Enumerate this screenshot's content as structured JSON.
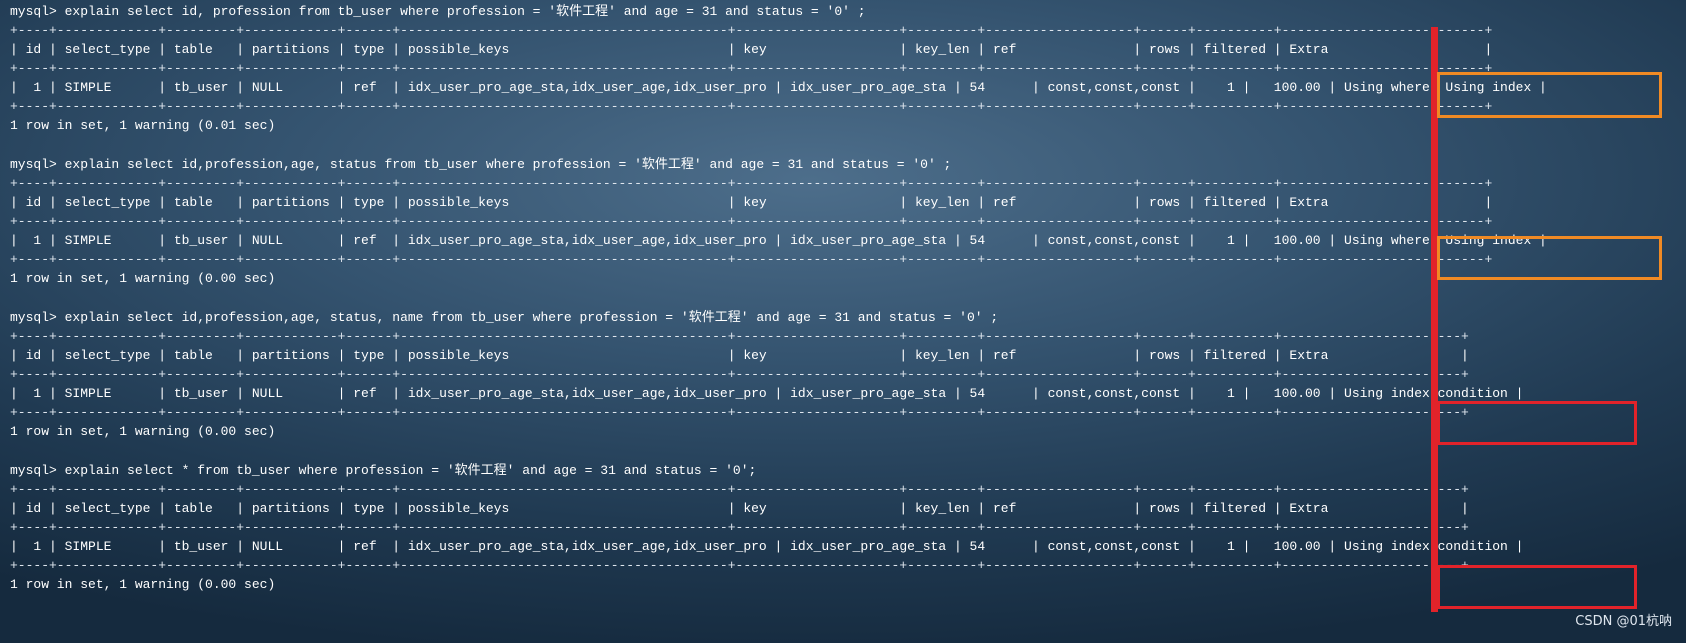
{
  "queries": [
    {
      "command": "mysql> explain select id, profession from tb_user where profession = '软件工程' and age = 31 and status = '0' ;",
      "border": "+----+-------------+---------+------------+------+------------------------------------------+---------------------+---------+-------------------+------+----------+--------------------------+",
      "header": "| id | select_type | table   | partitions | type | possible_keys                            | key                 | key_len | ref               | rows | filtered | Extra                    |",
      "row": "|  1 | SIMPLE      | tb_user | NULL       | ref  | idx_user_pro_age_sta,idx_user_age,idx_user_pro | idx_user_pro_age_sta | 54      | const,const,const |    1 |   100.00 | Using where; Using index |",
      "result": "1 row in set, 1 warning (0.01 sec)"
    },
    {
      "command": "mysql> explain select id,profession,age, status from tb_user where profession = '软件工程' and age = 31 and status = '0' ;",
      "border": "+----+-------------+---------+------------+------+------------------------------------------+---------------------+---------+-------------------+------+----------+--------------------------+",
      "header": "| id | select_type | table   | partitions | type | possible_keys                            | key                 | key_len | ref               | rows | filtered | Extra                    |",
      "row": "|  1 | SIMPLE      | tb_user | NULL       | ref  | idx_user_pro_age_sta,idx_user_age,idx_user_pro | idx_user_pro_age_sta | 54      | const,const,const |    1 |   100.00 | Using where; Using index |",
      "result": "1 row in set, 1 warning (0.00 sec)"
    },
    {
      "command": "mysql> explain select id,profession,age, status, name from tb_user where profession = '软件工程' and age = 31 and status = '0' ;",
      "border": "+----+-------------+---------+------------+------+------------------------------------------+---------------------+---------+-------------------+------+----------+-----------------------+",
      "header": "| id | select_type | table   | partitions | type | possible_keys                            | key                 | key_len | ref               | rows | filtered | Extra                 |",
      "row": "|  1 | SIMPLE      | tb_user | NULL       | ref  | idx_user_pro_age_sta,idx_user_age,idx_user_pro | idx_user_pro_age_sta | 54      | const,const,const |    1 |   100.00 | Using index condition |",
      "result": "1 row in set, 1 warning (0.00 sec)"
    },
    {
      "command": "mysql> explain select * from tb_user where profession = '软件工程' and age = 31 and status = '0';",
      "border": "+----+-------------+---------+------------+------+------------------------------------------+---------------------+---------+-------------------+------+----------+-----------------------+",
      "header": "| id | select_type | table   | partitions | type | possible_keys                            | key                 | key_len | ref               | rows | filtered | Extra                 |",
      "row": "|  1 | SIMPLE      | tb_user | NULL       | ref  | idx_user_pro_age_sta,idx_user_age,idx_user_pro | idx_user_pro_age_sta | 54      | const,const,const |    1 |   100.00 | Using index condition |",
      "result": "1 row in set, 1 warning (0.00 sec)"
    }
  ],
  "highlight_colors": {
    "orange": "#f08a24",
    "red": "#e2232a"
  },
  "watermark": "CSDN @01杭呐"
}
